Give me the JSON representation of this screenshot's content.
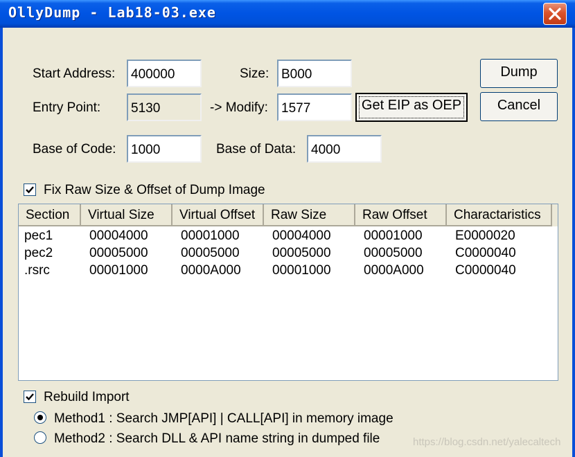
{
  "window": {
    "title": "OllyDump - Lab18-03.exe"
  },
  "form": {
    "start_address_label": "Start Address:",
    "start_address_value": "400000",
    "size_label": "Size:",
    "size_value": "B000",
    "entry_point_label": "Entry Point:",
    "entry_point_value": "5130",
    "modify_label": "-> Modify:",
    "modify_value": "1577",
    "base_code_label": "Base of Code:",
    "base_code_value": "1000",
    "base_data_label": "Base of Data:",
    "base_data_value": "4000"
  },
  "buttons": {
    "dump": "Dump",
    "cancel": "Cancel",
    "get_eip": "Get EIP as OEP"
  },
  "fix_raw": {
    "label": "Fix Raw Size & Offset of Dump Image",
    "checked": true
  },
  "sections": {
    "columns": [
      "Section",
      "Virtual Size",
      "Virtual Offset",
      "Raw Size",
      "Raw Offset",
      "Charactaristics"
    ],
    "rows": [
      [
        "pec1",
        "00004000",
        "00001000",
        "00004000",
        "00001000",
        "E0000020"
      ],
      [
        "pec2",
        "00005000",
        "00005000",
        "00005000",
        "00005000",
        "C0000040"
      ],
      [
        ".rsrc",
        "00001000",
        "0000A000",
        "00001000",
        "0000A000",
        "C0000040"
      ]
    ]
  },
  "rebuild": {
    "label": "Rebuild Import",
    "checked": true,
    "method1": "Method1 : Search JMP[API] | CALL[API] in memory image",
    "method2": "Method2 : Search DLL & API name string in dumped file",
    "selected": "method1"
  },
  "watermark": "https://blog.csdn.net/yalecaltech",
  "colors": {
    "titlebar": "#0054e3",
    "dialog_bg": "#ece9d8",
    "close_button": "#d9522b"
  }
}
